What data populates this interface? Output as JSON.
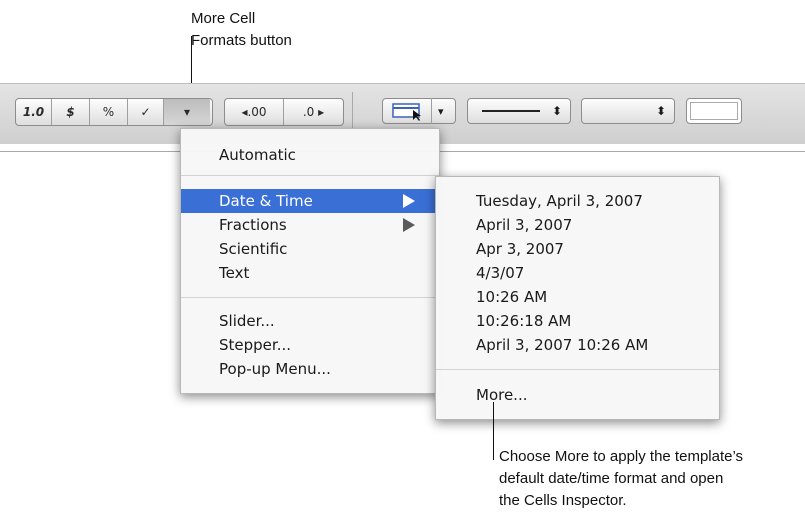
{
  "callout_top": {
    "line1": "More Cell",
    "line2": "Formats button"
  },
  "callout_bottom": {
    "line1": "Choose More to apply the template’s",
    "line2": "default date/time format and open",
    "line3": "the Cells Inspector."
  },
  "toolbar": {
    "decimal_label": "1.0",
    "currency_label": "$",
    "percent_label": "%",
    "checkbox_label": "✓",
    "more_formats_label": "▾",
    "increase_decimal_label": "◂.00",
    "decrease_decimal_label": ".0 ▸",
    "popup_arrow": "▾",
    "stepper_arrow": "⬍"
  },
  "format_menu": {
    "items": [
      {
        "label": "Automatic"
      },
      {
        "label": "Date & Time"
      },
      {
        "label": "Fractions"
      },
      {
        "label": "Scientific"
      },
      {
        "label": "Text"
      },
      {
        "label": "Slider..."
      },
      {
        "label": "Stepper..."
      },
      {
        "label": "Pop-up Menu..."
      }
    ]
  },
  "date_menu": {
    "items": [
      {
        "label": "Tuesday, April 3, 2007"
      },
      {
        "label": "April 3, 2007"
      },
      {
        "label": "Apr 3, 2007"
      },
      {
        "label": "4/3/07"
      },
      {
        "label": "10:26 AM"
      },
      {
        "label": "10:26:18 AM"
      },
      {
        "label": "April 3, 2007 10:26 AM"
      },
      {
        "label": "More..."
      }
    ]
  },
  "colors": {
    "selection": "#3a6fd6"
  }
}
